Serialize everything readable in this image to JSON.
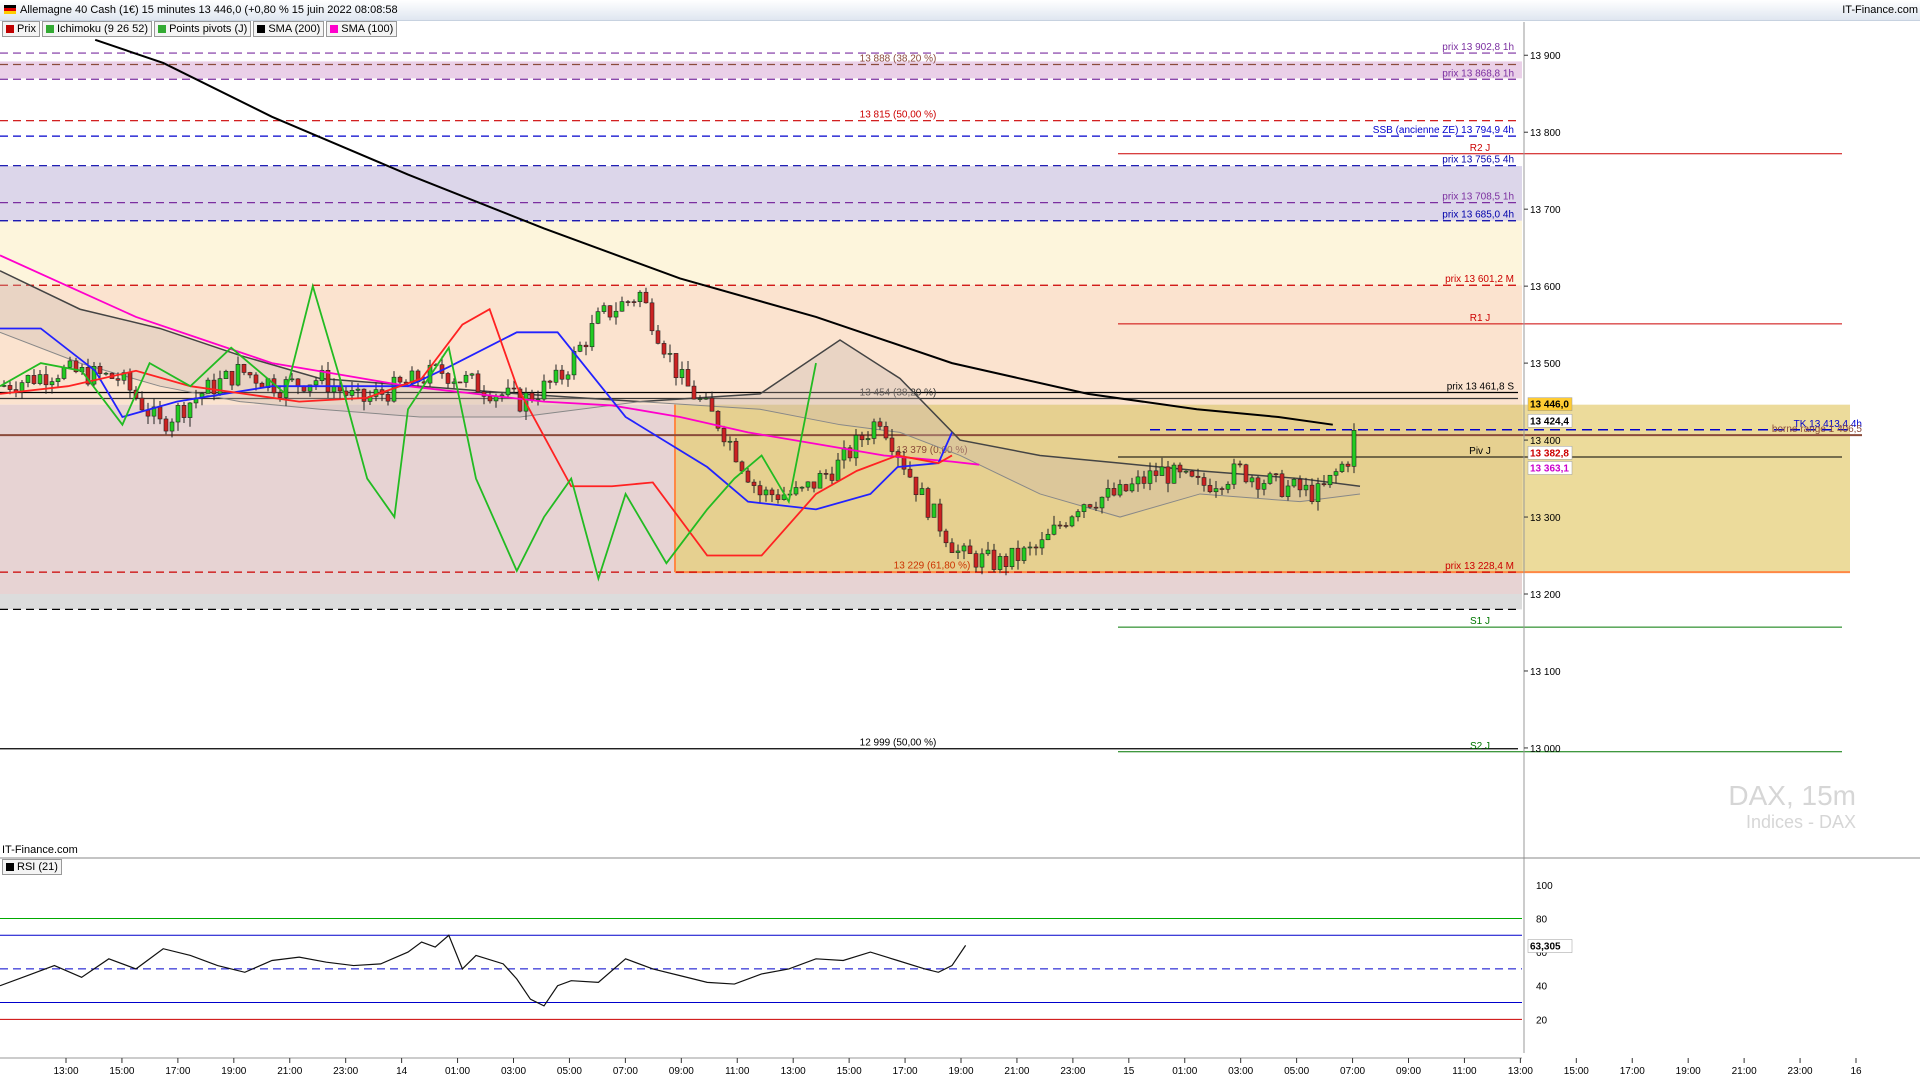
{
  "header": {
    "title": "Allemagne 40 Cash (1€) 15 minutes 13 446,0 (+0,80 % 15 juin 2022 08:08:58",
    "brand": "IT-Finance.com"
  },
  "legend": [
    {
      "label": "Prix",
      "color": "#c00000"
    },
    {
      "label": "Ichimoku (9 26 52)",
      "color": "#33aa33"
    },
    {
      "label": "Points pivots (J)",
      "color": "#33aa33"
    },
    {
      "label": "SMA (200)",
      "color": "#000000"
    },
    {
      "label": "SMA (100)",
      "color": "#ff00cc"
    }
  ],
  "source_label": "IT-Finance.com",
  "watermark": {
    "symbol": "DAX, 15m",
    "category": "Indices - DAX"
  },
  "rsi_label": "RSI (21)",
  "chart_data": {
    "type": "candlestick",
    "title": "Allemagne 40 Cash (1€) 15 minutes",
    "ylim": [
      12870,
      13925
    ],
    "y_ticks": [
      {
        "value": 13900,
        "label": "13 900"
      },
      {
        "value": 13800,
        "label": "13 800"
      },
      {
        "value": 13700,
        "label": "13 700"
      },
      {
        "value": 13600,
        "label": "13 600"
      },
      {
        "value": 13500,
        "label": "13 500"
      },
      {
        "value": 13400,
        "label": "13 400"
      },
      {
        "value": 13300,
        "label": "13 300"
      },
      {
        "value": 13200,
        "label": "13 200"
      },
      {
        "value": 13100,
        "label": "13 100"
      },
      {
        "value": 13000,
        "label": "13 000"
      }
    ],
    "x_ticks": [
      "13:00",
      "15:00",
      "17:00",
      "19:00",
      "21:00",
      "23:00",
      "14",
      "01:00",
      "03:00",
      "05:00",
      "07:00",
      "09:00",
      "11:00",
      "13:00",
      "15:00",
      "17:00",
      "19:00",
      "21:00",
      "23:00",
      "15",
      "01:00",
      "03:00",
      "05:00",
      "07:00",
      "09:00",
      "11:00",
      "13:00",
      "15:00",
      "17:00",
      "19:00",
      "21:00",
      "23:00",
      "16"
    ],
    "zones": [
      {
        "from": 13870,
        "to": 13892,
        "color": "#ead0e8"
      },
      {
        "from": 13685,
        "to": 13710,
        "color": "#cbb8e0"
      },
      {
        "from": 13685,
        "to": 13756,
        "color": "#dcd6ea"
      },
      {
        "from": 13601,
        "to": 13685,
        "color": "#fdf5dc"
      },
      {
        "from": 13446,
        "to": 13601,
        "color": "#fbe3cf"
      },
      {
        "from": 13200,
        "to": 13446,
        "color": "#e7d3d3"
      }
    ],
    "levels": [
      {
        "value": 13902.8,
        "label": "prix 13 902,8 1h",
        "color": "#7b2fa0",
        "style": "dash"
      },
      {
        "value": 13888,
        "label": "13 888 (38,20 %)",
        "color": "#8b4b3b",
        "style": "dash",
        "center": true
      },
      {
        "value": 13868.8,
        "label": "prix 13 868,8 1h",
        "color": "#7b2fa0",
        "style": "dash"
      },
      {
        "value": 13815,
        "label": "13 815 (50,00 %)",
        "color": "#cc0000",
        "style": "dash",
        "center": true
      },
      {
        "value": 13794.9,
        "label": "SSB (ancienne ZE) 13 794,9 4h",
        "color": "#0000cc",
        "style": "dash"
      },
      {
        "value": 13756.5,
        "label": "prix 13 756,5 4h",
        "color": "#0000aa",
        "style": "dash"
      },
      {
        "value": 13708.5,
        "label": "prix 13 708,5 1h",
        "color": "#7b2fa0",
        "style": "dash"
      },
      {
        "value": 13685,
        "label": "prix 13 685,0 4h",
        "color": "#0000aa",
        "style": "dash"
      },
      {
        "value": 13601.2,
        "label": "prix 13 601,2 M",
        "color": "#cc0000",
        "style": "dash"
      },
      {
        "value": 13461.8,
        "label": "prix 13 461,8 S",
        "color": "#000000",
        "style": "solid"
      },
      {
        "value": 13454,
        "label": "13 454 (38,20 %)",
        "color": "#333333",
        "style": "solid",
        "center": true
      },
      {
        "value": 13228.4,
        "label": "prix 13 228,4 M",
        "color": "#cc0000",
        "style": "dash"
      },
      {
        "value": 13180,
        "label": "",
        "color": "#000000",
        "style": "dash"
      },
      {
        "value": 12999,
        "label": "12 999 (50,00 %)",
        "color": "#000000",
        "style": "solid",
        "center": true
      }
    ],
    "pivots": [
      {
        "name": "R2 J",
        "value": 13772,
        "color": "#cc0000"
      },
      {
        "name": "R1 J",
        "value": 13551,
        "color": "#cc0000"
      },
      {
        "name": "Piv J",
        "value": 13378,
        "color": "#000000"
      },
      {
        "name": "S1 J",
        "value": 13157,
        "color": "#007700"
      },
      {
        "name": "S2 J",
        "value": 12995,
        "color": "#007700"
      }
    ],
    "fib_labels": [
      {
        "text": "13 379 (0,00 %)",
        "value": 13379,
        "color": "#8b4b3b"
      },
      {
        "text": "13 229 (61,80 %)",
        "value": 13229,
        "color": "#cc3300"
      }
    ],
    "annotations": [
      {
        "text": "TK 13 413,4 4h",
        "value": 13413.4,
        "color": "#0000cc"
      },
      {
        "text": "borne range 1 406,5",
        "value": 13406.5,
        "color": "#8b4b3b"
      }
    ],
    "price_tags": [
      {
        "value": 13446.0,
        "label": "13 446,0",
        "bg": "#ffcc33",
        "fg": "#000000"
      },
      {
        "value": 13424.4,
        "label": "13 424,4",
        "bg": "#ffffff",
        "fg": "#000000"
      },
      {
        "value": 13382.8,
        "label": "13 382,8",
        "bg": "#ffffff",
        "fg": "#cc0000"
      },
      {
        "value": 13363.1,
        "label": "13 363,1",
        "bg": "#ffffff",
        "fg": "#cc00cc"
      }
    ],
    "series": [
      {
        "name": "SMA (200)",
        "color": "#000000",
        "x": [
          0.07,
          0.12,
          0.2,
          0.3,
          0.4,
          0.5,
          0.6,
          0.7,
          0.8,
          0.88,
          0.94,
          0.98
        ],
        "y": [
          13920,
          13890,
          13820,
          13745,
          13675,
          13610,
          13560,
          13500,
          13460,
          13440,
          13430,
          13420
        ]
      },
      {
        "name": "SMA (100)",
        "color": "#ff00cc",
        "x": [
          0.0,
          0.05,
          0.1,
          0.15,
          0.2,
          0.25,
          0.3,
          0.35,
          0.4,
          0.45,
          0.5,
          0.55,
          0.6,
          0.65,
          0.7,
          0.72
        ],
        "y": [
          13640,
          13600,
          13560,
          13530,
          13500,
          13485,
          13470,
          13460,
          13450,
          13445,
          13430,
          13410,
          13395,
          13380,
          13372,
          13368
        ]
      },
      {
        "name": "Kijun",
        "color": "#2222ff",
        "x": [
          0.0,
          0.03,
          0.07,
          0.09,
          0.13,
          0.2,
          0.26,
          0.3,
          0.33,
          0.38,
          0.41,
          0.46,
          0.52,
          0.55,
          0.6,
          0.64,
          0.66,
          0.69,
          0.7
        ],
        "y": [
          13545,
          13545,
          13490,
          13430,
          13450,
          13470,
          13470,
          13470,
          13495,
          13540,
          13540,
          13430,
          13365,
          13320,
          13310,
          13330,
          13365,
          13370,
          13410
        ]
      },
      {
        "name": "Tenkan",
        "color": "#ff2222",
        "x": [
          0.0,
          0.05,
          0.1,
          0.14,
          0.18,
          0.22,
          0.27,
          0.31,
          0.34,
          0.36,
          0.38,
          0.42,
          0.45,
          0.48,
          0.52,
          0.56,
          0.6,
          0.63,
          0.66,
          0.69,
          0.7
        ],
        "y": [
          13460,
          13470,
          13490,
          13470,
          13460,
          13450,
          13455,
          13480,
          13550,
          13570,
          13470,
          13340,
          13340,
          13345,
          13250,
          13250,
          13330,
          13360,
          13380,
          13370,
          13380
        ]
      },
      {
        "name": "Chikou",
        "color": "#22bb22",
        "x": [
          0.0,
          0.03,
          0.06,
          0.09,
          0.11,
          0.14,
          0.17,
          0.21,
          0.23,
          0.25,
          0.27,
          0.29,
          0.3,
          0.33,
          0.35,
          0.38,
          0.4,
          0.42,
          0.44,
          0.46,
          0.49,
          0.52,
          0.54,
          0.56,
          0.58,
          0.6
        ],
        "y": [
          13470,
          13500,
          13490,
          13420,
          13500,
          13470,
          13520,
          13460,
          13600,
          13480,
          13350,
          13300,
          13440,
          13520,
          13350,
          13230,
          13300,
          13350,
          13220,
          13330,
          13240,
          13310,
          13350,
          13380,
          13320,
          13500
        ]
      }
    ],
    "rsi": {
      "ylim": [
        0,
        110
      ],
      "ticks": [
        100,
        80,
        60,
        40,
        20
      ],
      "last": {
        "value": 63.305,
        "label": "63,305"
      },
      "levels": [
        {
          "value": 80,
          "color": "#00aa00"
        },
        {
          "value": 70,
          "color": "#0000cc"
        },
        {
          "value": 50,
          "color": "#0000cc"
        },
        {
          "value": 30,
          "color": "#0000cc"
        },
        {
          "value": 20,
          "color": "#cc0000"
        }
      ],
      "x": [
        0.0,
        0.02,
        0.04,
        0.06,
        0.08,
        0.1,
        0.12,
        0.14,
        0.16,
        0.18,
        0.2,
        0.22,
        0.24,
        0.26,
        0.28,
        0.3,
        0.31,
        0.32,
        0.33,
        0.34,
        0.35,
        0.37,
        0.38,
        0.39,
        0.4,
        0.41,
        0.42,
        0.44,
        0.46,
        0.48,
        0.5,
        0.52,
        0.54,
        0.56,
        0.58,
        0.6,
        0.62,
        0.64,
        0.66,
        0.68,
        0.69,
        0.7,
        0.71
      ],
      "y": [
        40,
        46,
        52,
        45,
        56,
        50,
        62,
        58,
        52,
        48,
        55,
        57,
        54,
        52,
        53,
        60,
        66,
        63,
        70,
        50,
        58,
        53,
        44,
        32,
        28,
        40,
        43,
        42,
        56,
        50,
        46,
        42,
        41,
        47,
        50,
        56,
        55,
        60,
        55,
        50,
        48,
        52,
        64
      ]
    }
  }
}
